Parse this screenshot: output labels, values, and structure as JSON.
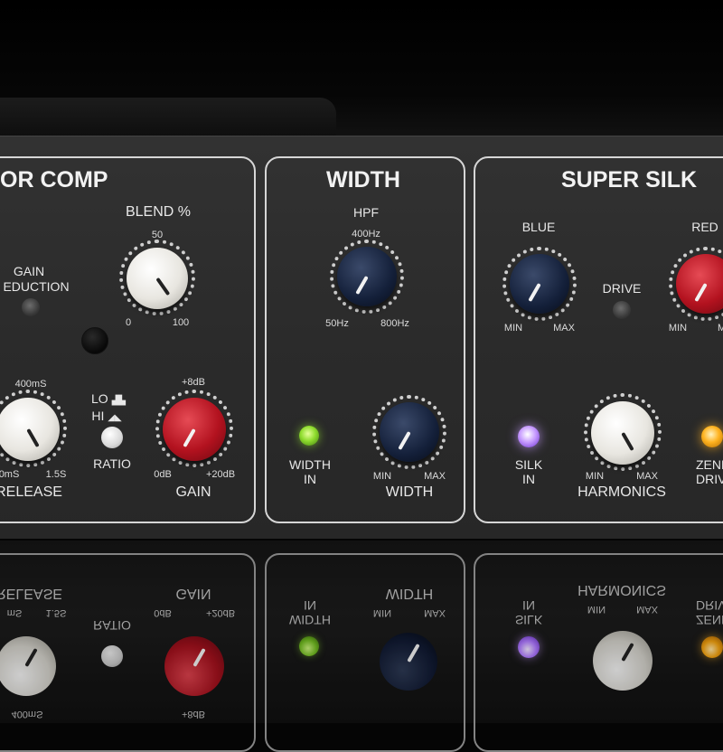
{
  "colors": {
    "panel_bg": "#2d2d2d",
    "panel_border": "#d6d6d6",
    "knob_white": "#e8e6e0",
    "knob_navy": "#14203a",
    "knob_red": "#b3121f",
    "led_green": "#8fdc2e",
    "led_purple": "#c79bff",
    "led_orange": "#ffb320"
  },
  "comp": {
    "title": "OR COMP",
    "gain_reduction_label_1": "GAIN",
    "gain_reduction_label_2": "EDUCTION",
    "blend": {
      "label": "BLEND %",
      "top": "50",
      "min": "0",
      "max": "100"
    },
    "release": {
      "label": "RELEASE",
      "top": "400mS",
      "min": "0mS",
      "max": "1.5S"
    },
    "ratio": {
      "label": "RATIO",
      "lo": "LO",
      "hi": "HI"
    },
    "gain": {
      "label": "GAIN",
      "top": "+8dB",
      "min": "0dB",
      "max": "+20dB"
    }
  },
  "width": {
    "title": "WIDTH",
    "hpf": {
      "label": "HPF",
      "top": "400Hz",
      "min": "50Hz",
      "max": "800Hz"
    },
    "width_in": {
      "line1": "WIDTH",
      "line2": "IN"
    },
    "width_knob": {
      "label": "WIDTH",
      "min": "MIN",
      "max": "MAX"
    }
  },
  "silk": {
    "title": "SUPER SILK",
    "blue": {
      "label": "BLUE",
      "min": "MIN",
      "max": "MAX"
    },
    "drive_label": "DRIVE",
    "red": {
      "label": "RED",
      "min": "MIN",
      "max": "M"
    },
    "silk_in": {
      "line1": "SILK",
      "line2": "IN"
    },
    "harmonics": {
      "label": "HARMONICS",
      "min": "MIN",
      "max": "MAX"
    },
    "zener": {
      "line1": "ZENE",
      "line2": "DRIV"
    }
  },
  "reflection": {
    "release": "RELEASE",
    "release_top": "400mS",
    "release_min": "mS",
    "release_max": "1.5S",
    "ratio": "RATIO",
    "gain": "GAIN",
    "gain_min": "0dB",
    "gain_max": "+20dB",
    "gain_top": "+8dB",
    "width": "WIDTH",
    "width_min": "MIN",
    "width_max": "MAX",
    "width_in_1": "IN",
    "width_in_2": "WIDTH",
    "silk_1": "IN",
    "silk_2": "SILK",
    "harmonics": "HARMONICS",
    "harm_min": "MIN",
    "harm_max": "MAX",
    "drive_1": "DRIV",
    "drive_2": "ZENE"
  }
}
